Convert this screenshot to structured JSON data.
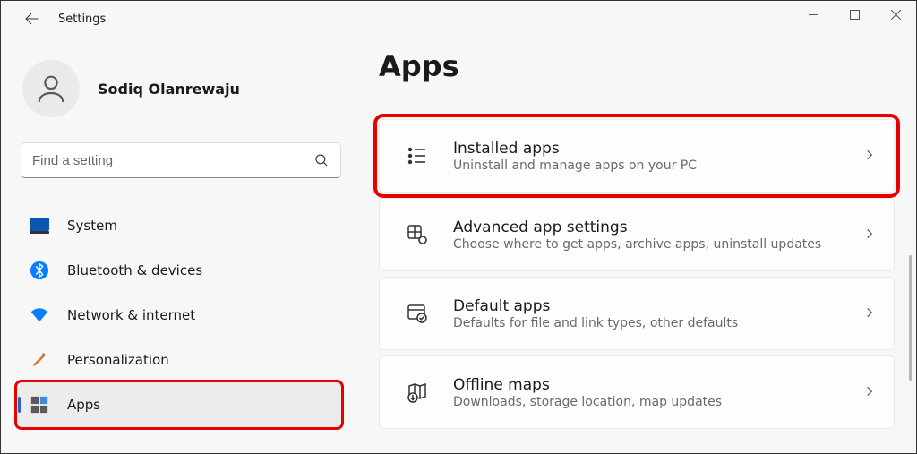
{
  "window": {
    "title": "Settings"
  },
  "user": {
    "name": "Sodiq Olanrewaju"
  },
  "search": {
    "placeholder": "Find a setting"
  },
  "sidebar": {
    "items": [
      {
        "id": "system",
        "label": "System",
        "selected": false
      },
      {
        "id": "bluetooth",
        "label": "Bluetooth & devices",
        "selected": false
      },
      {
        "id": "network",
        "label": "Network & internet",
        "selected": false
      },
      {
        "id": "personalization",
        "label": "Personalization",
        "selected": false
      },
      {
        "id": "apps",
        "label": "Apps",
        "selected": true,
        "highlighted": true
      }
    ]
  },
  "page": {
    "title": "Apps"
  },
  "cards": [
    {
      "id": "installed-apps",
      "title": "Installed apps",
      "subtitle": "Uninstall and manage apps on your PC",
      "highlighted": true
    },
    {
      "id": "advanced-app-settings",
      "title": "Advanced app settings",
      "subtitle": "Choose where to get apps, archive apps, uninstall updates",
      "highlighted": false
    },
    {
      "id": "default-apps",
      "title": "Default apps",
      "subtitle": "Defaults for file and link types, other defaults",
      "highlighted": false
    },
    {
      "id": "offline-maps",
      "title": "Offline maps",
      "subtitle": "Downloads, storage location, map updates",
      "highlighted": false
    }
  ]
}
